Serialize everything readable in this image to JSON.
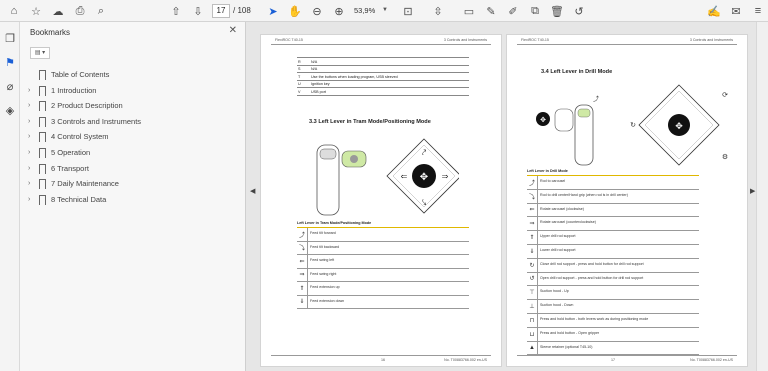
{
  "toolbar": {
    "page_current": "17",
    "page_total": "/ 108",
    "zoom": "53,9%"
  },
  "bookmarks": {
    "title": "Bookmarks",
    "options_label": "▤ ▾",
    "items": [
      {
        "label": "Table of Contents",
        "expandable": false
      },
      {
        "label": "1 Introduction",
        "expandable": true
      },
      {
        "label": "2 Product Description",
        "expandable": true
      },
      {
        "label": "3 Controls and Instruments",
        "expandable": true
      },
      {
        "label": "4 Control System",
        "expandable": true
      },
      {
        "label": "5 Operation",
        "expandable": true
      },
      {
        "label": "6 Transport",
        "expandable": true
      },
      {
        "label": "7 Daily Maintenance",
        "expandable": true
      },
      {
        "label": "8 Technical Data",
        "expandable": true
      }
    ]
  },
  "page_left": {
    "header_left": "FlexiROC T40-15",
    "header_right": "3 Controls and Instruments",
    "top_table": [
      {
        "k": "R",
        "v": "N/A"
      },
      {
        "k": "S",
        "v": "N/A"
      },
      {
        "k": "T",
        "v": "Use the buttons when loading program, USB sleeved"
      },
      {
        "k": "U",
        "v": "Ignition key"
      },
      {
        "k": "V",
        "v": "USB port"
      }
    ],
    "section_title": "3.3  Left Lever in Tram Mode/Positioning Mode",
    "table_caption": "Left Lever in Tram Mode/Positioning Mode",
    "rows": [
      "Feed tilt forward",
      "Feed tilt backward",
      "Feed swing left",
      "Feed swing right",
      "Feed extension up",
      "Feed extension down"
    ],
    "footer_page": "16",
    "footer_doc": "No. T00883766.002 en-US"
  },
  "page_right": {
    "header_left": "FlexiROC T40-15",
    "header_right": "3 Controls and Instruments",
    "section_title": "3.4  Left Lever in Drill Mode",
    "table_caption": "Left Lever in Drill Mode",
    "rows": [
      "Rod to carousel",
      "Rod to drill center/Hand grip (when rod is in drill center)",
      "Rotate carousel (clockwise)",
      "Rotate carousel (counterclockwise)",
      "Upper drill rod support",
      "Lower drill rod support",
      "Close drill rod support - press and hold button for drill rod support",
      "Open drill rod support - press and hold button for drill rod support",
      "Suction hood - Up",
      "Suction hood - Down",
      "Press and hold button - both levers work as during positioning mode",
      "Press and hold button - Open gripper",
      "Sleeve retainer (optional T45-10)"
    ],
    "footer_page": "17",
    "footer_doc": "No. T00883766.002 en-US"
  }
}
